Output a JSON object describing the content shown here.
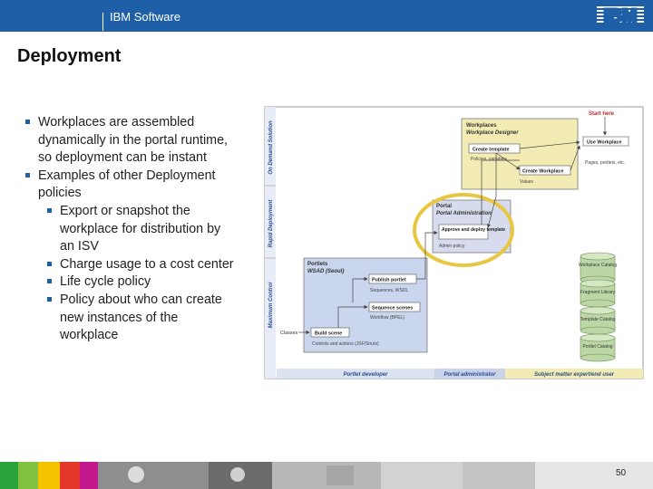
{
  "header": {
    "brand": "IBM Software",
    "logo_text": "IBM",
    "bar_color": "#1f5fa8"
  },
  "slide": {
    "title": "Deployment",
    "bullets": [
      {
        "level": 1,
        "text": "Workplaces are assembled dynamically in the portal runtime, so deployment can be instant"
      },
      {
        "level": 1,
        "text": "Examples of other Deployment policies"
      },
      {
        "level": 2,
        "text": "Export or snapshot the workplace for distribution by an ISV"
      },
      {
        "level": 2,
        "text": "Charge usage to a cost center"
      },
      {
        "level": 2,
        "text": "Life cycle policy"
      },
      {
        "level": 2,
        "text": "Policy about who can create new instances of the workplace"
      }
    ],
    "page_number": "50"
  },
  "diagram": {
    "side_labels": [
      "On Demand Solution",
      "Rapid Deployment",
      "Maximum Control"
    ],
    "start_here": "Start here",
    "workplaces": {
      "title": "Workplaces",
      "subtitle": "Workplace Designer"
    },
    "create_template": "Create template",
    "policies_variables": "Policies, variables",
    "use_workplace": "Use Workplace",
    "pages_portlets": "Pages, portlets, etc.",
    "create_workplace": "Create Workplace",
    "values": "Values",
    "portal": {
      "title": "Portal",
      "subtitle": "Portal Administration"
    },
    "approve_deploy": "Approve and deploy template",
    "admin_policy": "Admin policy",
    "portlets": {
      "title": "Portlets",
      "subtitle": "WSAD (Seoul)"
    },
    "publish_portlet": "Publish portlet",
    "sequences_wsdl": "Sequences, WSDL",
    "sequence_scenes": "Sequence scenes",
    "workflow": "Workflow (BPEL)",
    "classes": "Classes",
    "build_scene": "Build scene",
    "controls": "Controls and actions (JSF/Struts)",
    "catalogs": [
      "Workplace Catalog",
      "Fragment Library",
      "Template Catalog",
      "Portlet Catalog"
    ],
    "roles": [
      "Portlet developer",
      "Portal administrator",
      "Subject matter expert/end user"
    ],
    "colors": {
      "workplaces_box": "#f2ecb4",
      "portal_box": "#d6dced",
      "portlets_box": "#c9d6ee",
      "highlight_circle": "#e8c640",
      "start_here": "#c1272d",
      "catalog": "#bcd7a5"
    }
  }
}
